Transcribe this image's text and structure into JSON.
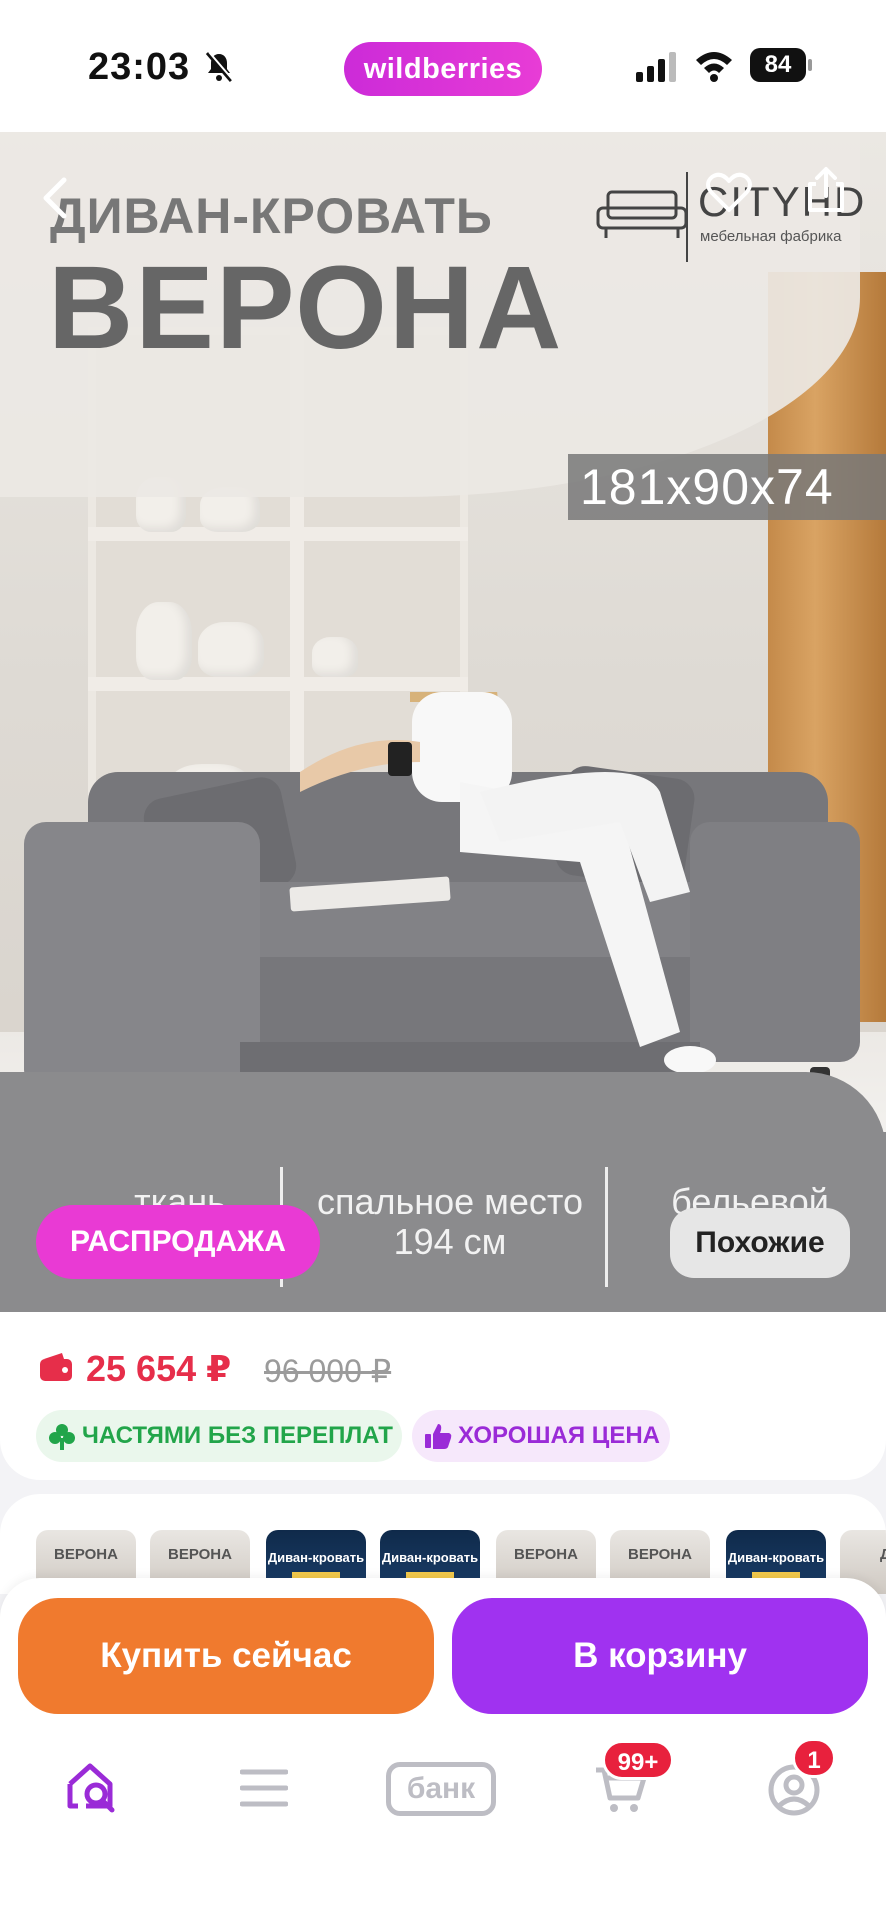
{
  "status_bar": {
    "time": "23:03",
    "app_pill": "wildberries",
    "battery": "84"
  },
  "hero": {
    "title_small": "ДИВАН-КРОВАТЬ",
    "title_big": "ВЕРОНА",
    "brand_name": "CITYHD",
    "brand_sub": "мебельная фабрика",
    "size": "181x90x74",
    "features": [
      "ткань",
      "спальное место 194 см",
      "бельевой"
    ]
  },
  "chips": {
    "sale": "РАСПРОДАЖА",
    "similar": "Похожие"
  },
  "price": {
    "current": "25 654 ₽",
    "old": "96 000 ₽",
    "installments": "ЧАСТЯМИ БЕЗ ПЕРЕПЛАТ",
    "good_price": "ХОРОШАЯ ЦЕНА"
  },
  "thumbnails": [
    {
      "text": "ВЕРОНА",
      "style": "light"
    },
    {
      "text": "ВЕРОНА",
      "style": "light"
    },
    {
      "text": "Диван-кровать",
      "style": "dark"
    },
    {
      "text": "Диван-кровать",
      "style": "dark"
    },
    {
      "text": "ВЕРОНА",
      "style": "light"
    },
    {
      "text": "ВЕРОНА",
      "style": "light"
    },
    {
      "text": "Диван-кровать",
      "style": "dark"
    },
    {
      "text": "Ди",
      "style": "light"
    }
  ],
  "actions": {
    "buy_now": "Купить сейчас",
    "add_to_cart": "В корзину"
  },
  "tab_bar": {
    "bank": "банк",
    "cart_badge": "99+",
    "profile_badge": "1"
  },
  "colors": {
    "accent_pink": "#e93ad4",
    "buy_orange": "#f07a2e",
    "cart_purple": "#a032f0",
    "price_red": "#e62e4a"
  }
}
